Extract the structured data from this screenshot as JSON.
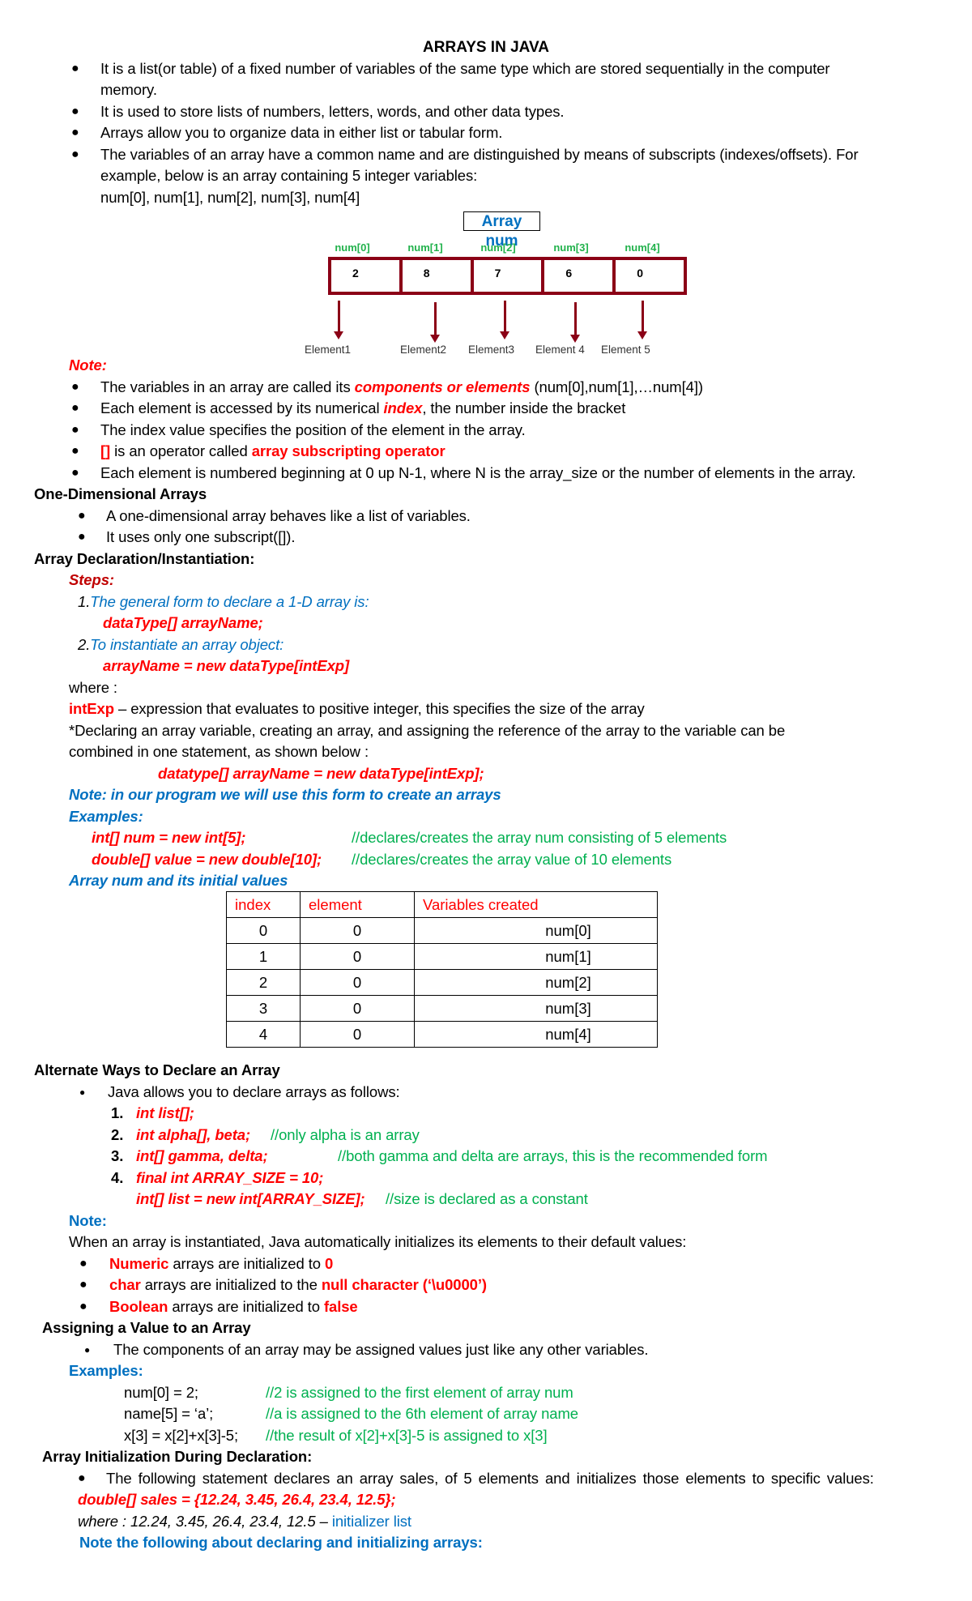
{
  "title": "ARRAYS IN JAVA",
  "intro_bullets": [
    {
      "line1": "It is a list(or table) of a fixed number  of variables of the same type which  are stored sequentially in the computer",
      "line2": "memory."
    },
    {
      "line1": "It is used to store lists of numbers, letters, words, and other data types."
    },
    {
      "line1": "Arrays allow you to organize data in either list or tabular form."
    },
    {
      "line1": "The variables of an array have a common name and are distinguished by means of subscripts (indexes/offsets). For",
      "line2": "example, below is an array containing 5 integer variables:",
      "line3": "num[0], num[1], num[2], num[3], num[4]"
    }
  ],
  "diagram": {
    "title": "Array num",
    "cells": [
      {
        "label": "num[0]",
        "value": "2",
        "element": "Element1"
      },
      {
        "label": "num[1]",
        "value": "8",
        "element": "Element2"
      },
      {
        "label": "num[2]",
        "value": "7",
        "element": "Element3"
      },
      {
        "label": "num[3]",
        "value": "6",
        "element": "Element 4"
      },
      {
        "label": "num[4]",
        "value": "0",
        "element": "Element 5"
      }
    ]
  },
  "note1": {
    "heading": "Note:",
    "b1": {
      "pre": "The variables in an array are called its ",
      "em": "components or elements",
      "post": " (num[0],num[1],…num[4])"
    },
    "b2": {
      "pre": "Each element is accessed by its numerical ",
      "em": "index",
      "post": ", the number inside the bracket"
    },
    "b3": "The index value specifies the position of the element in the array.",
    "b4": {
      "op": "[]",
      "mid": " is an operator called ",
      "em": "array subscripting operator"
    },
    "b5": "Each element is numbered beginning at 0 up N-1, where N is the array_size or  the number of elements in the array."
  },
  "one_dim": {
    "heading": "One-Dimensional Arrays",
    "bullets": [
      "A one-dimensional array behaves like a list of variables.",
      "It uses only one subscript([])."
    ]
  },
  "declaration": {
    "heading": "Array Declaration/Instantiation:",
    "steps_label": "Steps:",
    "step1_num": "1.",
    "step1_text": "The general form to declare a 1-D array is:",
    "step1_code": "dataType[] arrayName;",
    "step2_num": "2.",
    "step2_text": "To instantiate an array object:",
    "step2_code": "arrayName = new dataType[intExp]",
    "where": "where :",
    "intexp_term": "intExp",
    "intexp_desc": " – expression that evaluates to positive integer, this specifies the size  of the array",
    "combined_line1": "*Declaring an array variable, creating an array, and assigning the reference of the array  to the variable can be",
    "combined_line2": "combined in one statement, as shown below :",
    "combined_code": "datatype[] arrayName = new dataType[intExp];",
    "program_note": "Note: in our program we will use this form to create an arrays",
    "examples_label": "Examples:",
    "examples": [
      {
        "code": "int[] num = new int[5];",
        "comment": "//declares/creates the array num consisting of 5 elements"
      },
      {
        "code": "double[] value = new double[10];",
        "comment": "//declares/creates the array value of 10 elements"
      }
    ],
    "table_caption": "Array num and its initial values"
  },
  "table": {
    "headers": [
      "index",
      "element",
      "Variables created"
    ],
    "rows": [
      [
        "0",
        "0",
        "num[0]"
      ],
      [
        "1",
        "0",
        "num[1]"
      ],
      [
        "2",
        "0",
        "num[2]"
      ],
      [
        "3",
        "0",
        "num[3]"
      ],
      [
        "4",
        "0",
        "num[4]"
      ]
    ]
  },
  "alternate": {
    "heading": "Alternate Ways to Declare an Array",
    "bullet": "Java allows you to declare arrays as follows:",
    "items": [
      {
        "num": "1.",
        "code": "int list[];",
        "comment": ""
      },
      {
        "num": "2.",
        "code": "int alpha[], beta;",
        "comment": "//only alpha is an array"
      },
      {
        "num": "3.",
        "code": "int[] gamma, delta;",
        "comment": "//both gamma and delta are arrays, this is the recommended form"
      },
      {
        "num": "4.",
        "code": "final int ARRAY_SIZE = 10;",
        "comment": ""
      },
      {
        "num": "",
        "code": "int[] list = new int[ARRAY_SIZE];",
        "comment": "//size is declared as a constant"
      }
    ],
    "note_label": "Note:",
    "note_text": "When an array is instantiated, Java automatically initializes its elements to their default   values:",
    "defaults": [
      {
        "type": "Numeric",
        "mid": " arrays are initialized to ",
        "value": "0"
      },
      {
        "type": "char",
        "mid": " arrays are initialized to the ",
        "value": "null character (‘\\u0000’)"
      },
      {
        "type": "Boolean",
        "mid": " arrays are initialized to ",
        "value": "false"
      }
    ]
  },
  "assigning": {
    "heading": "Assigning a Value to an Array",
    "bullet": "The components of an array may be assigned values just like any other variables.",
    "examples_label": "Examples:",
    "examples": [
      {
        "code": "num[0] = 2;",
        "comment": "//2 is assigned to the first element of array num"
      },
      {
        "code": "name[5] = ‘a’;",
        "comment": "//a is assigned to the 6th element of array name"
      },
      {
        "code": "x[3] = x[2]+x[3]-5;",
        "comment": "//the result of x[2]+x[3]-5 is assigned to x[3]"
      }
    ]
  },
  "init": {
    "heading": "Array Initialization During Declaration:",
    "bullet": "The following statement declares an array sales, of 5 elements and initializes those elements to specific values:",
    "code": "double[] sales = {12.24, 3.45, 26.4, 23.4, 12.5};",
    "where_text": "where :  12.24, 3.45, 26.4, 23.4, 12.5 – ",
    "where_term": "initializer list",
    "note": "Note the following about declaring and initializing arrays:"
  }
}
